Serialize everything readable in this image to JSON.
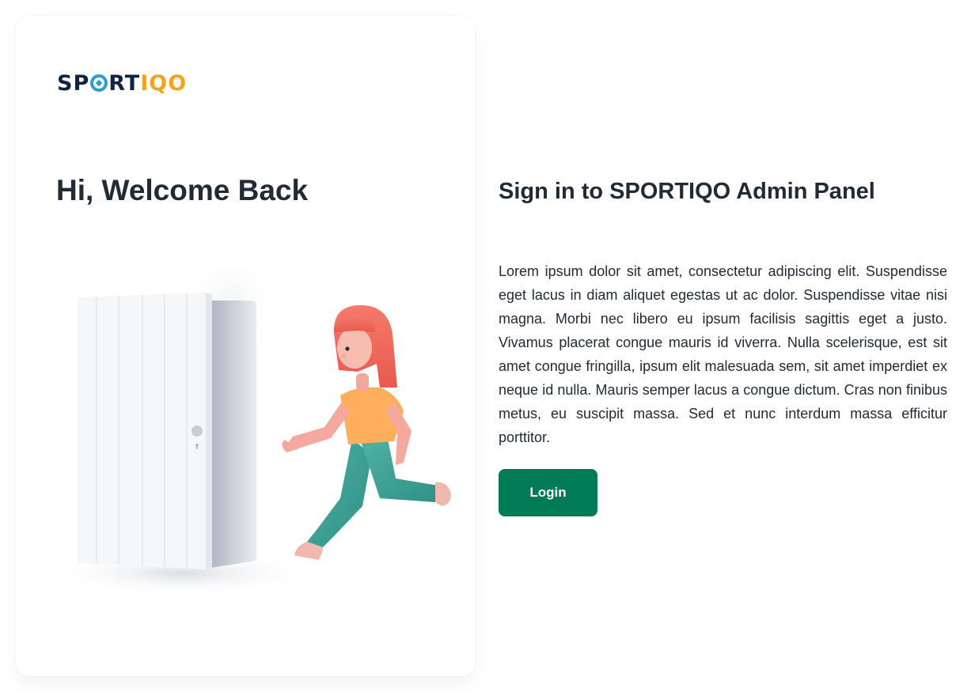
{
  "brand": {
    "logo_prefix": "SP",
    "logo_middle": "RT",
    "logo_suffix": "IQO",
    "logo_full": "SPORTIQO",
    "colors": {
      "navy": "#0f2440",
      "blue": "#2f9bd6",
      "orange": "#f5a31a"
    }
  },
  "left_panel": {
    "greeting": "Hi, Welcome Back",
    "illustration": "girl-running-out-of-door-illustration"
  },
  "right_panel": {
    "title": "Sign in to SPORTIQO Admin Panel",
    "description": "Lorem ipsum dolor sit amet, consectetur adipiscing elit. Suspendisse eget lacus in diam aliquet egestas ut ac dolor. Suspendisse vitae nisi magna. Morbi nec libero eu ipsum facilisis sagittis eget a justo. Vivamus placerat congue mauris id viverra. Nulla scelerisque, est sit amet congue fringilla, ipsum elit malesuada sem, sit amet imperdiet ex neque id nulla. Mauris semper lacus a congue dictum. Cras non finibus metus, eu suscipit massa. Sed et nunc interdum massa efficitur porttitor.",
    "login_label": "Login",
    "accent": "#007b55"
  }
}
